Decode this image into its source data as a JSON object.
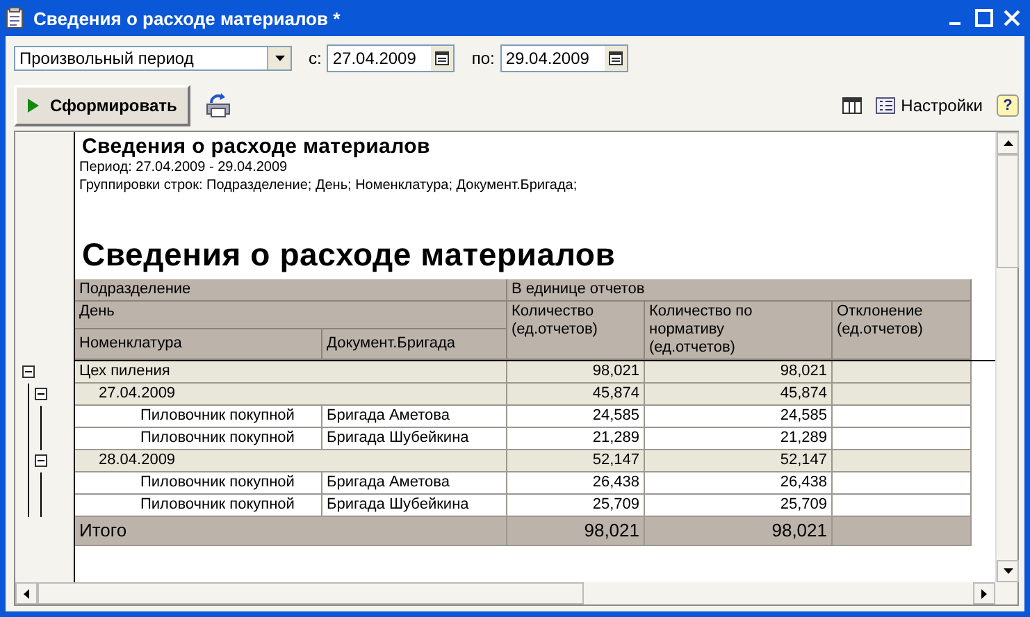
{
  "window": {
    "title": "Сведения о расходе материалов *"
  },
  "filter": {
    "period": "Произвольный период",
    "from_label": "с:",
    "from": "27.04.2009",
    "to_label": "по:",
    "to": "29.04.2009"
  },
  "toolbar": {
    "generate": "Сформировать",
    "settings": "Настройки",
    "help": "?"
  },
  "report": {
    "title": "Сведения о расходе материалов",
    "period": "Период: 27.04.2009 - 29.04.2009",
    "grouping": "Группировки строк: Подразделение; День; Номенклатура; Документ.Бригада;",
    "heading": "Сведения о расходе материалов",
    "header": {
      "level1": "Подразделение",
      "level2": "День",
      "level3": "Номенклатура",
      "brigade": "Документ.Бригада",
      "group": "В единице отчетов",
      "columns": [
        "Количество (ед.отчетов)",
        "Количество по нормативу (ед.отчетов)",
        "Отклонение (ед.отчетов)"
      ]
    },
    "rows": [
      {
        "label": "Цех пиления",
        "qty": "98,021",
        "norm": "98,021",
        "expanded": true,
        "children": [
          {
            "label": "27.04.2009",
            "qty": "45,874",
            "norm": "45,874",
            "expanded": true,
            "children": [
              {
                "label": "Пиловочник покупной",
                "brigade": "Бригада Аметова",
                "qty": "24,585",
                "norm": "24,585"
              },
              {
                "label": "Пиловочник покупной",
                "brigade": "Бригада Шубейкина",
                "qty": "21,289",
                "norm": "21,289"
              }
            ]
          },
          {
            "label": "28.04.2009",
            "qty": "52,147",
            "norm": "52,147",
            "expanded": true,
            "children": [
              {
                "label": "Пиловочник покупной",
                "brigade": "Бригада Аметова",
                "qty": "26,438",
                "norm": "26,438"
              },
              {
                "label": "Пиловочник покупной",
                "brigade": "Бригада Шубейкина",
                "qty": "25,709",
                "norm": "25,709"
              }
            ]
          }
        ]
      }
    ],
    "total": {
      "label": "Итого",
      "qty": "98,021",
      "norm": "98,021"
    }
  }
}
